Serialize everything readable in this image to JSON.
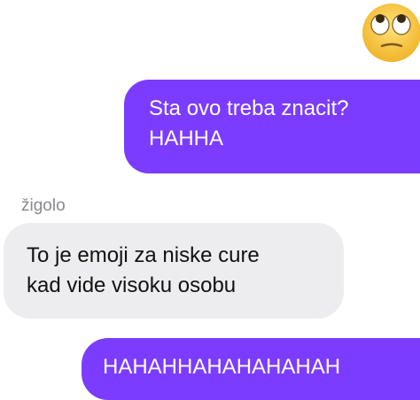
{
  "emoji": {
    "name": "eye-roll-emoji-icon",
    "face_color": "#f7c43a"
  },
  "messages": [
    {
      "direction": "outgoing",
      "text": "Sta ovo treba znacit?\nHAHHA"
    },
    {
      "direction": "incoming",
      "sender": "žigolo",
      "text": "To je emoji za niske cure\nkad vide visoku osobu"
    },
    {
      "direction": "outgoing",
      "text": "HAHAHHAHAHAHAHAH"
    }
  ],
  "colors": {
    "outgoing_bubble": "#7b3cff",
    "incoming_bubble": "#ededf0"
  }
}
